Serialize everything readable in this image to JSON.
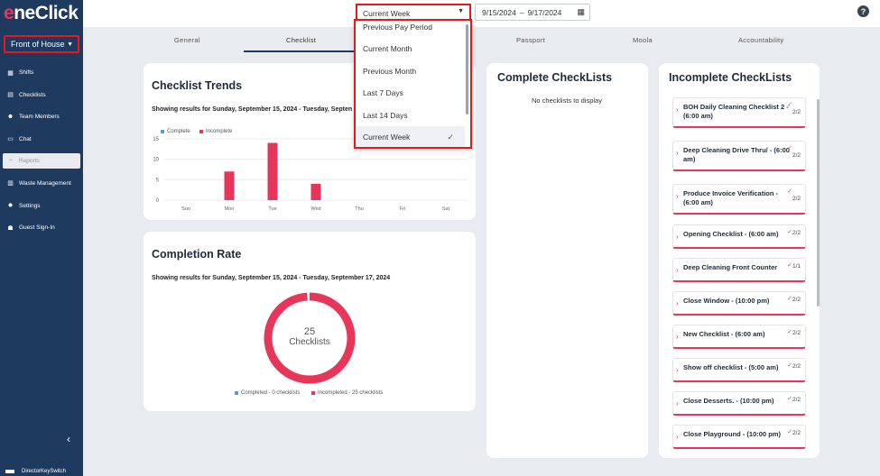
{
  "brand": {
    "logo_e": "e",
    "logo_rest": "neClick",
    "accent": "#e8365b",
    "sidebar_bg": "#1e3a5f",
    "highlight": "#e8171a"
  },
  "location": {
    "label": "Front of House"
  },
  "nav": [
    {
      "label": "Shifts",
      "icon": "calendar-icon",
      "glyph": "▦"
    },
    {
      "label": "Checklists",
      "icon": "clipboard-icon",
      "glyph": "▤"
    },
    {
      "label": "Team Members",
      "icon": "users-icon",
      "glyph": "☻"
    },
    {
      "label": "Chat",
      "icon": "chat-icon",
      "glyph": "▭"
    },
    {
      "label": "Reports",
      "icon": "pie-chart-icon",
      "glyph": "◔",
      "active": true
    },
    {
      "label": "Waste Management",
      "icon": "trash-icon",
      "glyph": "▥"
    },
    {
      "label": "Settings",
      "icon": "gear-icon",
      "glyph": "✹"
    },
    {
      "label": "Guest Sign-In",
      "icon": "guest-icon",
      "glyph": "☗"
    }
  ],
  "footer_user": "DirectorKeySwitch",
  "period": {
    "selected": "Current Week",
    "options": [
      "Previous Pay Period",
      "Current Month",
      "Previous Month",
      "Last 7 Days",
      "Last 14 Days",
      "Current Week"
    ]
  },
  "date_range": {
    "start": "9/15/2024",
    "sep": "–",
    "end": "9/17/2024"
  },
  "tabs": [
    "General",
    "Checklist",
    "Passport",
    "Moola",
    "Accountability"
  ],
  "trends": {
    "title": "Checklist Trends",
    "subtitle": "Showing results for Sunday, September 15, 2024 - Tuesday, Septen",
    "legend_complete": "Complete",
    "legend_incomplete": "Incomplete"
  },
  "completion": {
    "title": "Completion Rate",
    "subtitle": "Showing results for Sunday, September 15, 2024 - Tuesday, September 17, 2024",
    "center_number": "25",
    "center_label": "Checklists",
    "legend_completed": "Completed  - 0 checklists",
    "legend_incompleted": "Incompleted - 25 checklists",
    "completed": 0,
    "incompleted": 25
  },
  "complete_list": {
    "title": "Complete CheckLists",
    "empty": "No checklists to display"
  },
  "incomplete_list": {
    "title": "Incomplete CheckLists",
    "items": [
      {
        "name": "BOH Daily Cleaning Checklist 2 - (6:00 am)",
        "count": "2/2"
      },
      {
        "name": "Deep Cleaning Drive Thru/ - (6:00 am)",
        "count": "2/2"
      },
      {
        "name": "Produce Invoice Verification - (6:00 am)",
        "count": "2/2"
      },
      {
        "name": "Opening Checklist - (6:00 am)",
        "count": "2/2"
      },
      {
        "name": "Deep Cleaning Front Counter",
        "count": "1/1"
      },
      {
        "name": "Close Window - (10:00 pm)",
        "count": "2/2"
      },
      {
        "name": "New Checklist - (6:00 am)",
        "count": "2/2"
      },
      {
        "name": "Show off checklist - (5:00 am)",
        "count": "2/2"
      },
      {
        "name": "Close Desserts. - (10:00 pm)",
        "count": "2/2"
      },
      {
        "name": "Close Playground - (10:00 pm)",
        "count": "2/2"
      }
    ]
  },
  "chart_data": {
    "type": "bar",
    "categories": [
      "Sun",
      "Mon",
      "Tue",
      "Wed",
      "Thu",
      "Fri",
      "Sat"
    ],
    "series": [
      {
        "name": "Complete",
        "values": [
          0,
          0,
          0,
          0,
          0,
          0,
          0
        ],
        "color": "#5b9bd5"
      },
      {
        "name": "Incomplete",
        "values": [
          0,
          7,
          14,
          4,
          0,
          0,
          0
        ],
        "color": "#e8365b"
      }
    ],
    "yticks": [
      "0",
      "5",
      "10",
      "15"
    ],
    "ylim": [
      0,
      15
    ],
    "legend": "top-left",
    "grid": true
  }
}
